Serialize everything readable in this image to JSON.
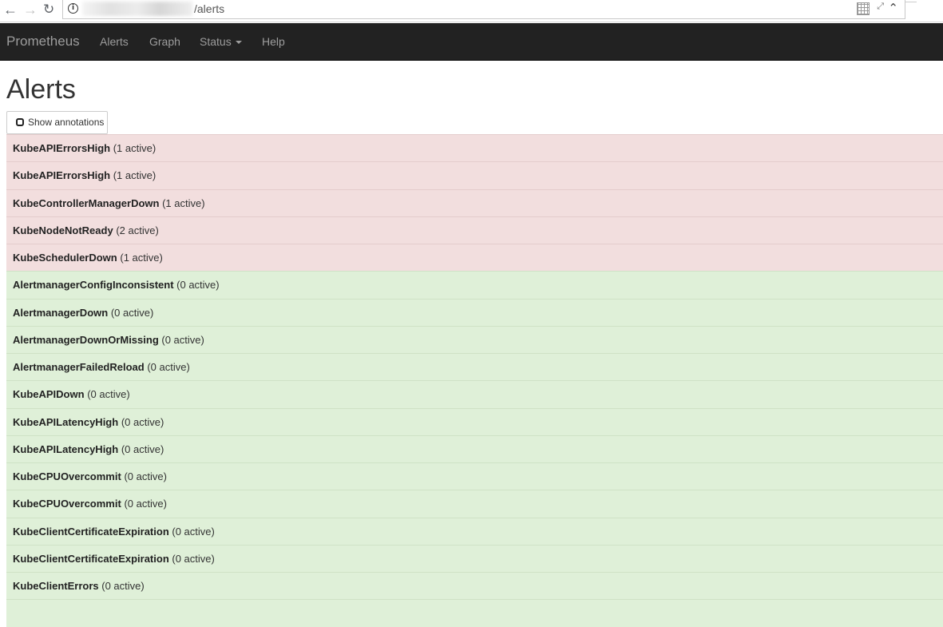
{
  "browser": {
    "url_path": "/alerts",
    "icons": {
      "back": "arrow-left-icon",
      "forward": "arrow-right-icon",
      "reload": "reload-icon",
      "info": "info-icon"
    }
  },
  "navbar": {
    "brand": "Prometheus",
    "links": [
      "Alerts",
      "Graph",
      "Status",
      "Help"
    ],
    "background": "#222222",
    "link_color": "#9d9d9d"
  },
  "page": {
    "title": "Alerts",
    "show_annotations_label": "Show annotations"
  },
  "colors": {
    "firing": "#f2dede",
    "inactive": "#dff0d8"
  },
  "alerts": [
    {
      "name": "KubeAPIErrorsHigh",
      "count": "(1 active)",
      "state": "firing"
    },
    {
      "name": "KubeAPIErrorsHigh",
      "count": "(1 active)",
      "state": "firing"
    },
    {
      "name": "KubeControllerManagerDown",
      "count": "(1 active)",
      "state": "firing"
    },
    {
      "name": "KubeNodeNotReady",
      "count": "(2 active)",
      "state": "firing"
    },
    {
      "name": "KubeSchedulerDown",
      "count": "(1 active)",
      "state": "firing"
    },
    {
      "name": "AlertmanagerConfigInconsistent",
      "count": "(0 active)",
      "state": "inactive"
    },
    {
      "name": "AlertmanagerDown",
      "count": "(0 active)",
      "state": "inactive"
    },
    {
      "name": "AlertmanagerDownOrMissing",
      "count": "(0 active)",
      "state": "inactive"
    },
    {
      "name": "AlertmanagerFailedReload",
      "count": "(0 active)",
      "state": "inactive"
    },
    {
      "name": "KubeAPIDown",
      "count": "(0 active)",
      "state": "inactive"
    },
    {
      "name": "KubeAPILatencyHigh",
      "count": "(0 active)",
      "state": "inactive"
    },
    {
      "name": "KubeAPILatencyHigh",
      "count": "(0 active)",
      "state": "inactive"
    },
    {
      "name": "KubeCPUOvercommit",
      "count": "(0 active)",
      "state": "inactive"
    },
    {
      "name": "KubeCPUOvercommit",
      "count": "(0 active)",
      "state": "inactive"
    },
    {
      "name": "KubeClientCertificateExpiration",
      "count": "(0 active)",
      "state": "inactive"
    },
    {
      "name": "KubeClientCertificateExpiration",
      "count": "(0 active)",
      "state": "inactive"
    },
    {
      "name": "KubeClientErrors",
      "count": "(0 active)",
      "state": "inactive"
    },
    {
      "name": "",
      "count": "",
      "state": "inactive"
    }
  ]
}
